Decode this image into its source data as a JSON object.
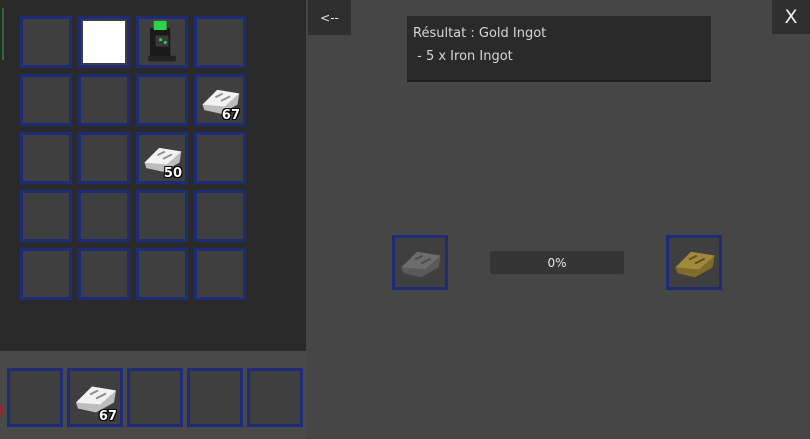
{
  "inventory": {
    "slots": [
      {
        "item": "",
        "qty": ""
      },
      {
        "item": "white-block",
        "qty": ""
      },
      {
        "item": "machine",
        "qty": ""
      },
      {
        "item": "",
        "qty": ""
      },
      {
        "item": "",
        "qty": ""
      },
      {
        "item": "",
        "qty": ""
      },
      {
        "item": "",
        "qty": ""
      },
      {
        "item": "iron-ingot",
        "qty": "67"
      },
      {
        "item": "",
        "qty": ""
      },
      {
        "item": "",
        "qty": ""
      },
      {
        "item": "iron-ingot",
        "qty": "50"
      },
      {
        "item": "",
        "qty": ""
      },
      {
        "item": "",
        "qty": ""
      },
      {
        "item": "",
        "qty": ""
      },
      {
        "item": "",
        "qty": ""
      },
      {
        "item": "",
        "qty": ""
      },
      {
        "item": "",
        "qty": ""
      },
      {
        "item": "",
        "qty": ""
      },
      {
        "item": "",
        "qty": ""
      },
      {
        "item": "",
        "qty": ""
      }
    ]
  },
  "hotbar": {
    "slots": [
      {
        "item": "",
        "qty": ""
      },
      {
        "item": "iron-ingot",
        "qty": "67"
      },
      {
        "item": "",
        "qty": ""
      },
      {
        "item": "",
        "qty": ""
      },
      {
        "item": "",
        "qty": ""
      }
    ]
  },
  "crafting": {
    "back_label": "<--",
    "close_label": "X",
    "result_title": "Résultat : Gold Ingot",
    "result_ingredient": " - 5 x Iron Ingot",
    "progress_value": 0,
    "progress_label": "0%",
    "input_item": "iron-ingot-ghost",
    "output_item": "gold-ingot-ghost"
  },
  "colors": {
    "slot_border": "#1e2c78",
    "iron": "#e6e6e6",
    "gold": "#a08a3a"
  }
}
